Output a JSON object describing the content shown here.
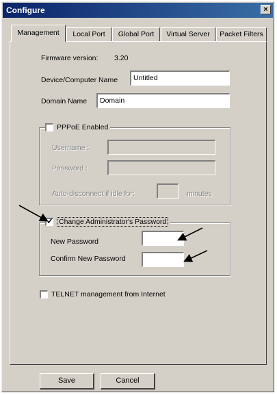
{
  "window": {
    "title": "Configure",
    "close_glyph": "×"
  },
  "tabs": [
    {
      "label": "Management",
      "active": true
    },
    {
      "label": "Local Port"
    },
    {
      "label": "Global Port"
    },
    {
      "label": "Virtual Server"
    },
    {
      "label": "Packet Filters"
    }
  ],
  "management": {
    "firmware_label": "Firmware version:",
    "firmware_value": "3.20",
    "device_name_label": "Device/Computer Name",
    "device_name_value": "Untitled",
    "domain_name_label": "Domain Name",
    "domain_name_value": "Domain"
  },
  "pppoe": {
    "enabled_label": "PPPoE Enabled",
    "enabled": false,
    "username_label": "Username :",
    "username_value": "",
    "password_label": "Password :",
    "password_value": "",
    "auto_disconnect_label": "Auto-disconnect if idle for:",
    "auto_disconnect_value": "",
    "minutes_label": "minutes"
  },
  "admin_password": {
    "change_label": "Change Administrator's Password",
    "checked": true,
    "check_glyph": "✓",
    "new_password_label": "New Password",
    "new_password_value": "",
    "confirm_password_label": "Confirm New Password",
    "confirm_password_value": ""
  },
  "telnet": {
    "label": "TELNET management from Internet",
    "checked": false
  },
  "buttons": {
    "save": "Save",
    "cancel": "Cancel"
  },
  "annotations": {
    "arrow_icon": "annotation-arrow-icon",
    "arrow_color": "#000000"
  }
}
